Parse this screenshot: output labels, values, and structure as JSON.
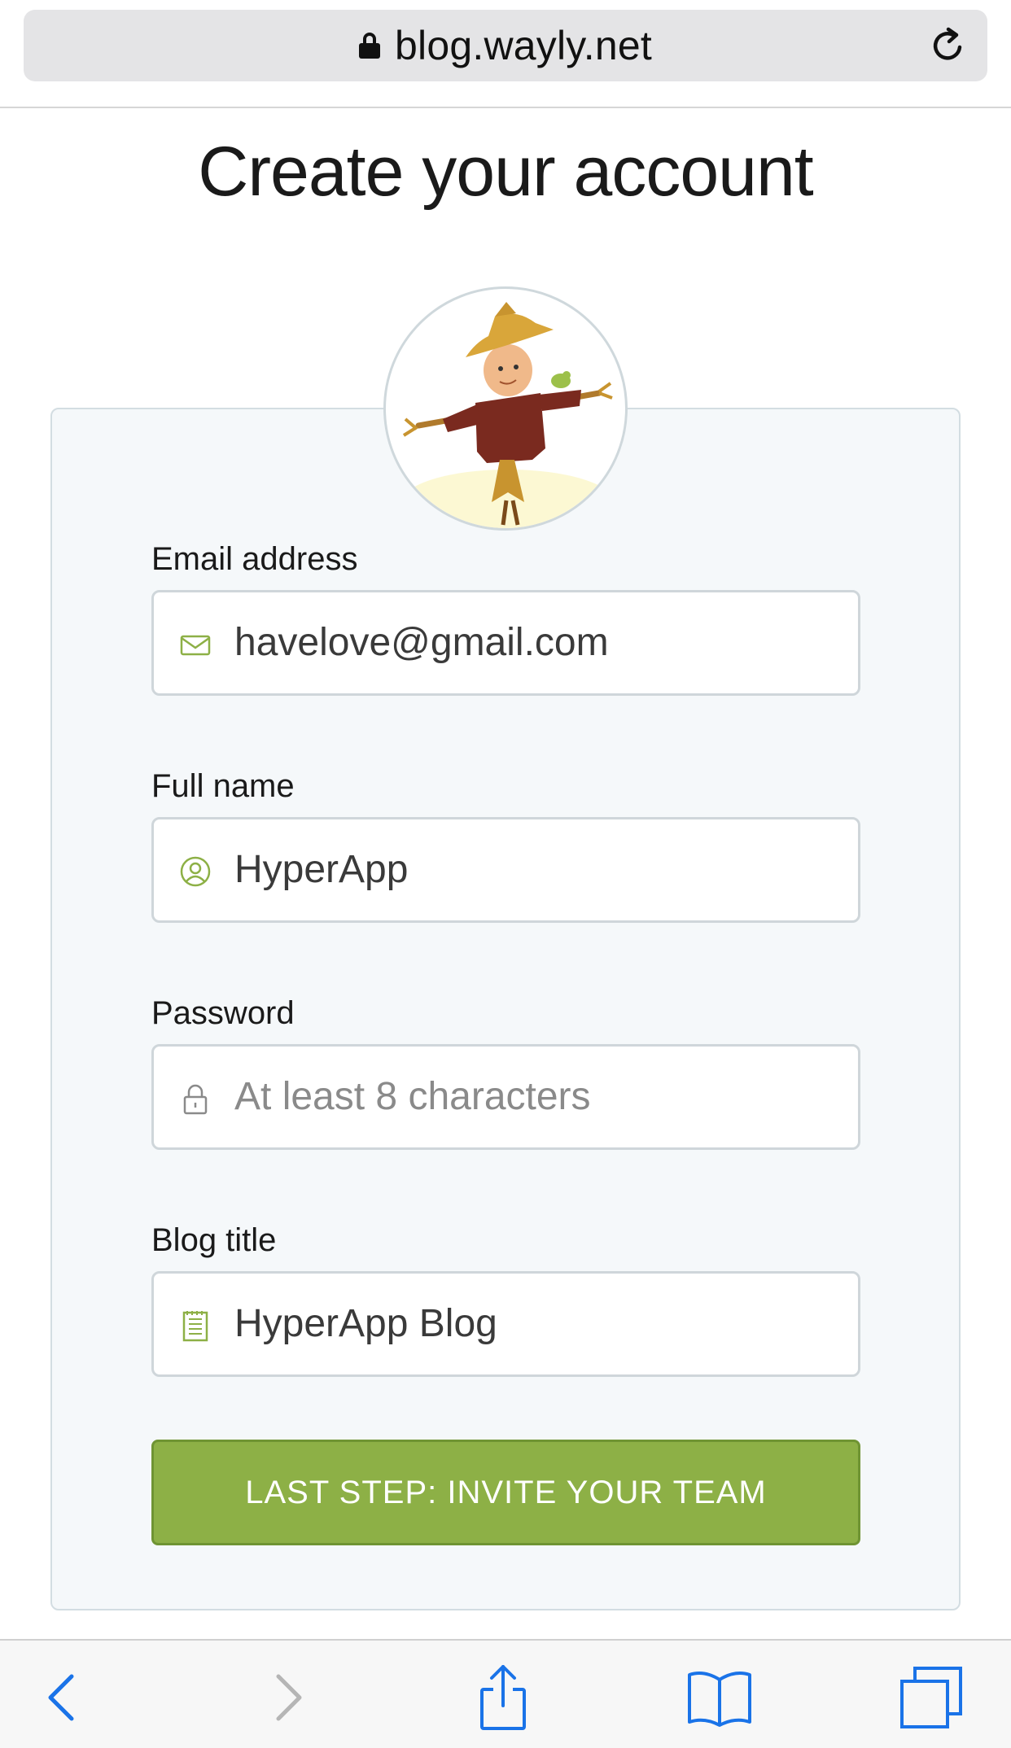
{
  "browser": {
    "url": "blog.wayly.net"
  },
  "page": {
    "title": "Create your account"
  },
  "form": {
    "email": {
      "label": "Email address",
      "value": "havelove@gmail.com",
      "icon": "envelope-icon"
    },
    "full_name": {
      "label": "Full name",
      "value": "HyperApp",
      "icon": "user-icon"
    },
    "password": {
      "label": "Password",
      "placeholder": "At least 8 characters",
      "icon": "lock-icon"
    },
    "blog_title": {
      "label": "Blog title",
      "value": "HyperApp Blog",
      "icon": "notepad-icon"
    },
    "submit_label": "LAST STEP: INVITE YOUR TEAM"
  },
  "colors": {
    "accent_green": "#8db046",
    "icon_green": "#8db046",
    "link_blue": "#1a73e8"
  }
}
